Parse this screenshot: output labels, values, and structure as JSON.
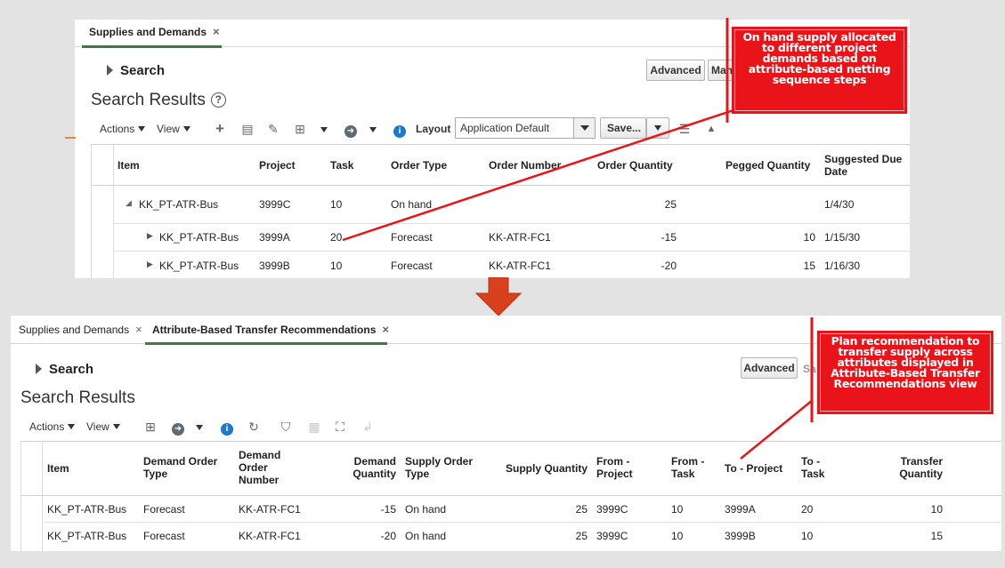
{
  "top_panel": {
    "tab": "Supplies and Demands",
    "tab_close": "×",
    "search_label": "Search",
    "advanced_button": "Advanced",
    "manage_button": "Mana",
    "results_title": "Search Results",
    "help_icon": "?",
    "toolbar": {
      "actions": "Actions",
      "view": "View",
      "layout_label": "Layout",
      "layout_value": "Application Default",
      "save_button": "Save..."
    },
    "columns": [
      "Item",
      "Project",
      "Task",
      "Order Type",
      "Order Number",
      "Order Quantity",
      "Pegged Quantity",
      "Suggested Due Date"
    ],
    "rows": [
      {
        "item": "KK_PT-ATR-Bus",
        "project": "3999C",
        "task": "10",
        "order_type": "On hand",
        "order_number": "",
        "order_quantity": "25",
        "pegged_quantity": "",
        "due_date": "1/4/30"
      },
      {
        "item": "KK_PT-ATR-Bus",
        "project": "3999A",
        "task": "20",
        "order_type": "Forecast",
        "order_number": "KK-ATR-FC1",
        "order_quantity": "-15",
        "pegged_quantity": "10",
        "due_date": "1/15/30"
      },
      {
        "item": "KK_PT-ATR-Bus",
        "project": "3999B",
        "task": "10",
        "order_type": "Forecast",
        "order_number": "KK-ATR-FC1",
        "order_quantity": "-20",
        "pegged_quantity": "15",
        "due_date": "1/16/30"
      }
    ]
  },
  "bottom_panel": {
    "tab_inactive": "Supplies and Demands",
    "tab_active": "Attribute-Based Transfer Recommendations",
    "tab_close": "×",
    "search_label": "Search",
    "advanced_button": "Advanced",
    "save_partial": "Sa",
    "results_title": "Search Results",
    "toolbar": {
      "actions": "Actions",
      "view": "View"
    },
    "columns": [
      {
        "label": "Item"
      },
      {
        "label": "Demand Order Type"
      },
      {
        "label": "Demand Order Number"
      },
      {
        "label": "Demand Quantity"
      },
      {
        "label": "Supply Order Type"
      },
      {
        "label": "Supply Quantity"
      },
      {
        "label": "From - Project"
      },
      {
        "label": "From - Task"
      },
      {
        "label": "To - Project"
      },
      {
        "label": "To - Task"
      },
      {
        "label": "Transfer Quantity"
      }
    ],
    "rows": [
      {
        "item": "KK_PT-ATR-Bus",
        "demand_order_type": "Forecast",
        "demand_order_number": "KK-ATR-FC1",
        "demand_quantity": "-15",
        "supply_order_type": "On hand",
        "supply_quantity": "25",
        "from_project": "3999C",
        "from_task": "10",
        "to_project": "3999A",
        "to_task": "20",
        "transfer_quantity": "10"
      },
      {
        "item": "KK_PT-ATR-Bus",
        "demand_order_type": "Forecast",
        "demand_order_number": "KK-ATR-FC1",
        "demand_quantity": "-20",
        "supply_order_type": "On hand",
        "supply_quantity": "25",
        "from_project": "3999C",
        "from_task": "10",
        "to_project": "3999B",
        "to_task": "10",
        "transfer_quantity": "15"
      }
    ]
  },
  "callouts": {
    "top": "On hand supply allocated to different project demands based on attribute-based netting sequence steps",
    "bottom": "Plan recommendation to transfer supply across attributes displayed in Attribute-Based Transfer Recommendations view"
  },
  "colors": {
    "callout_red": "#e8141a",
    "arrow_orange": "#d9401c",
    "tab_accent": "#3e7b3e",
    "info_blue": "#1f78c8"
  }
}
